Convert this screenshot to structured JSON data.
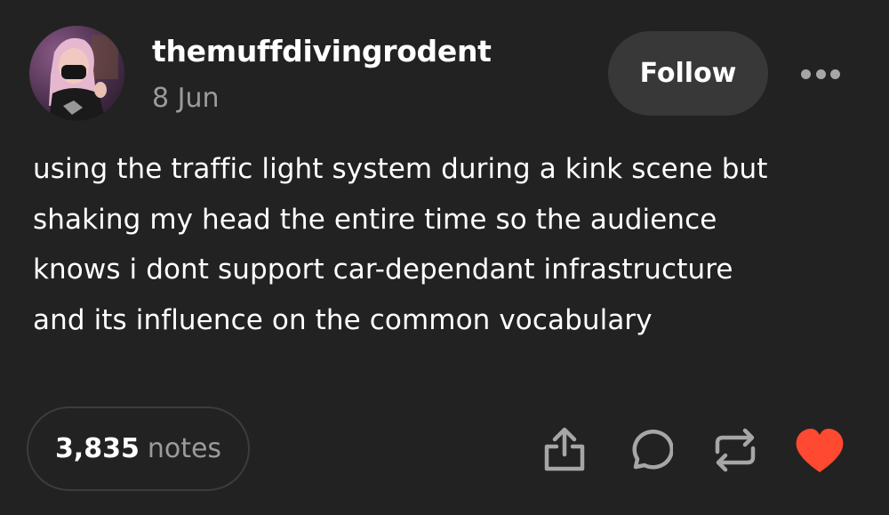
{
  "post": {
    "username": "themuffdivingrodent",
    "date": "8 Jun",
    "follow_label": "Follow",
    "body_lines": [
      "using the traffic light system during a kink scene but",
      "shaking my head the entire time so the audience",
      "knows i dont support car-dependant infrastructure",
      "and its influence on the common vocabulary"
    ],
    "notes_count": "3,835",
    "notes_label": "notes",
    "actions": [
      "share-icon",
      "reply-icon",
      "reblog-icon",
      "like-heart-icon"
    ]
  },
  "colors": {
    "background": "#222222",
    "text": "#ffffff",
    "muted": "#9b9b9b",
    "follow_bg": "#383838",
    "like": "#ff4930"
  }
}
